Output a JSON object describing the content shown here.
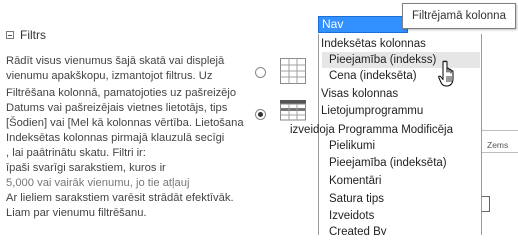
{
  "section": {
    "title": "Filtrs"
  },
  "description": {
    "lines": [
      "Rādīt visus vienumus šajā skatā vai displejā",
      "vienumu apakškopu, izmantojot filtrus. Uz",
      "Filtrēšana kolonnā, pamatojoties uz pašreizējo",
      "Datums vai pašreizējais vietnes lietotājs, tips",
      "[Šodien] vai [Mel kā kolonnas vērtība. Lietošana",
      "Indeksētas kolonnas pirmajā klauzulā secīgi",
      " , lai paātrinātu skatu. Filtri ir:",
      "īpaši svarīgi sarakstiem, kuros ir",
      "5,000 vai vairāk vienumu, jo tie atļauj",
      "Ar lieliem sarakstiem varēsit strādāt efektīvāk.",
      "Liam par vienumu filtrēšanu."
    ]
  },
  "options": {
    "show_all": {
      "selected": false,
      "icon": "table-grid-icon"
    },
    "show_filtered": {
      "selected": true,
      "icon": "filtered-table-icon"
    }
  },
  "dropdown": {
    "selected_value": "Nav",
    "tooltip": "Filtrējamā kolonna",
    "items": [
      {
        "label": "Indeksētas kolonnas",
        "kind": "group"
      },
      {
        "label": "Pieejamība (indekss)",
        "kind": "child",
        "hovered": true
      },
      {
        "label": "Cena (indeksēta)",
        "kind": "child"
      },
      {
        "label": "Visas kolonnas",
        "kind": "group"
      },
      {
        "label": "Lietojumprogrammu",
        "kind": "group"
      },
      {
        "label": "Pielikumi",
        "kind": "child"
      },
      {
        "label": "Pieejamība (indeksēta)",
        "kind": "child"
      },
      {
        "label": "Komentāri",
        "kind": "child"
      },
      {
        "label": "Satura tips",
        "kind": "child"
      },
      {
        "label": "Izveidots",
        "kind": "child"
      },
      {
        "label": "Created By",
        "kind": "child"
      }
    ],
    "overflow_item": "izveidoja Programma Modificēja"
  },
  "background": {
    "fragment": "Zems"
  },
  "colors": {
    "selection_blue": "#3390ff",
    "hover_gray": "#e6e6e6"
  }
}
